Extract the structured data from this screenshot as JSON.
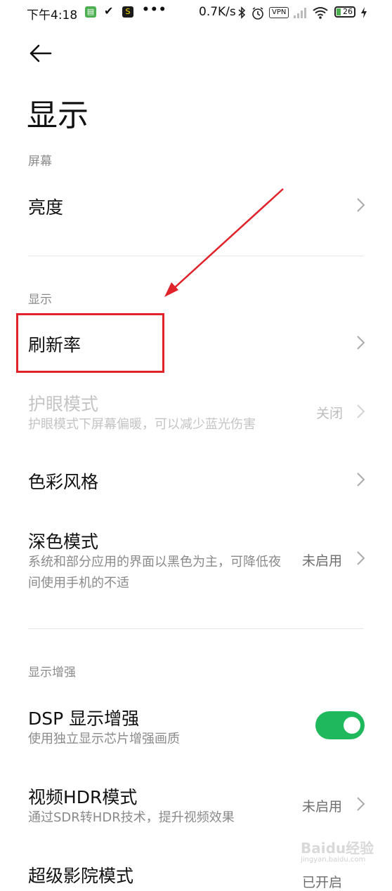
{
  "status_bar": {
    "time": "下午4:18",
    "dots": "•••",
    "speed": "0.7K/s",
    "vpn": "VPN",
    "battery": "26",
    "battery_level": 0.26
  },
  "header": {
    "title": "显示"
  },
  "sections": {
    "screen": "屏幕",
    "display": "显示",
    "enhance": "显示增强"
  },
  "items": {
    "brightness": {
      "title": "亮度"
    },
    "refresh_rate": {
      "title": "刷新率"
    },
    "eye_care": {
      "title": "护眼模式",
      "subtitle": "护眼模式下屏幕偏暖，可以减少蓝光伤害",
      "value": "关闭"
    },
    "color_style": {
      "title": "色彩风格"
    },
    "dark_mode": {
      "title": "深色模式",
      "subtitle": "系统和部分应用的界面以黑色为主，可降低夜间使用手机的不适",
      "value": "未启用"
    },
    "dsp": {
      "title": "DSP 显示增强",
      "subtitle": "使用独立显示芯片增强画质",
      "enabled": true
    },
    "video_hdr": {
      "title": "视频HDR模式",
      "subtitle": "通过SDR转HDR技术，提升视频效果",
      "value": "未启用"
    },
    "cinema": {
      "title": "超级影院模式",
      "value": "已开启"
    }
  },
  "watermark": {
    "text": "Baidu经验",
    "sub": "jingyan.baidu.com"
  },
  "colors": {
    "accent": "#1fb85c",
    "annotation": "#e0232b"
  }
}
